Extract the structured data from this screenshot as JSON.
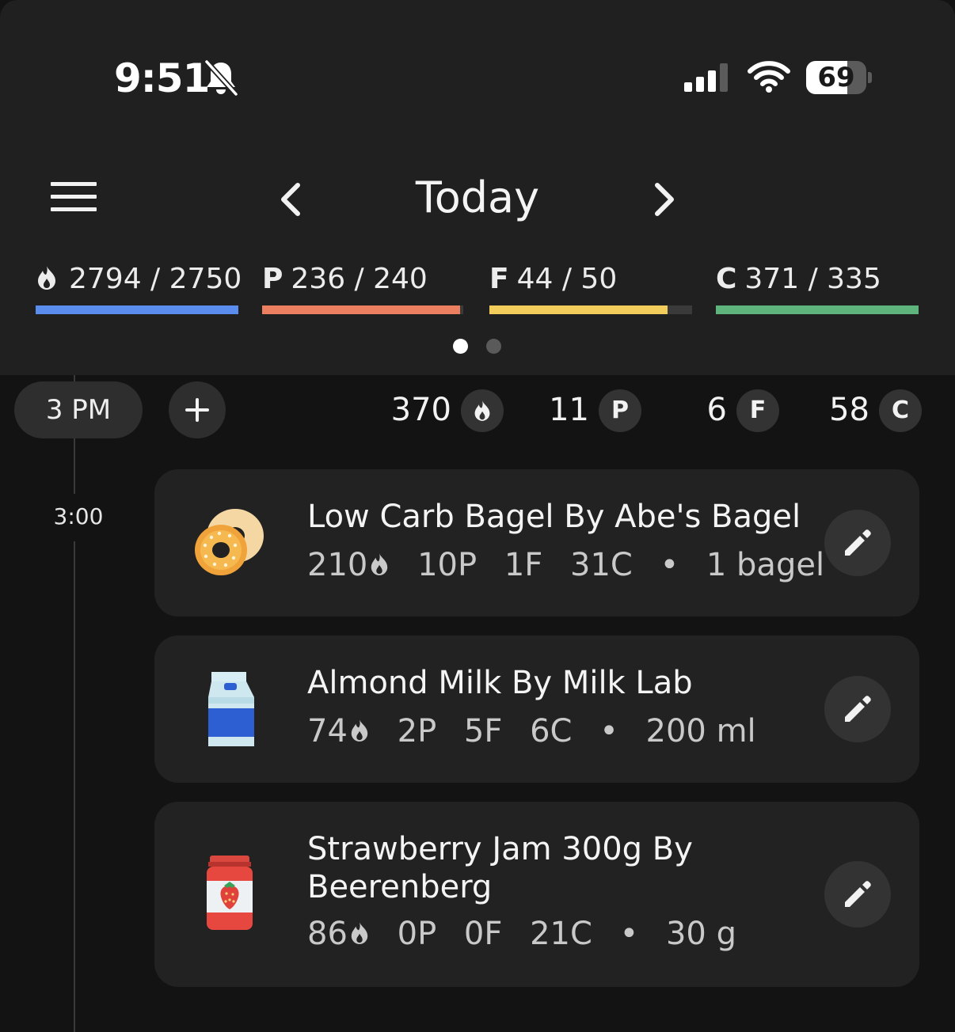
{
  "status": {
    "time": "9:51",
    "battery": "69",
    "battery_level": 0.69
  },
  "header": {
    "title": "Today",
    "icons": [
      "menu-icon",
      "chevron-left-icon",
      "chevron-right-icon"
    ]
  },
  "macros": [
    {
      "letter": "",
      "icon": "flame-icon",
      "text": "2794 / 2750",
      "progress": 1.0,
      "color": "#5b8def"
    },
    {
      "letter": "P",
      "text": "236 / 240",
      "progress": 0.983,
      "color": "#ec7f60"
    },
    {
      "letter": "F",
      "text": "44 / 50",
      "progress": 0.88,
      "color": "#f3cd5c"
    },
    {
      "letter": "C",
      "text": "371 / 335",
      "progress": 1.0,
      "color": "#5fb37c"
    }
  ],
  "pager": {
    "active": 0,
    "count": 2
  },
  "group": {
    "time_label": "3 PM",
    "stamp": "3:00",
    "totals": [
      {
        "value": "370",
        "badge": "",
        "icon": "flame-icon"
      },
      {
        "value": "11",
        "badge": "P"
      },
      {
        "value": "6",
        "badge": "F"
      },
      {
        "value": "58",
        "badge": "C"
      }
    ]
  },
  "foods": [
    {
      "name": "Low Carb Bagel By Abe's Bagel",
      "calories": "210",
      "protein": "10P",
      "fat": "1F",
      "carbs": "31C",
      "separator": "•",
      "serving": "1 bagel",
      "icon": "bagel-icon"
    },
    {
      "name": "Almond Milk By Milk Lab",
      "calories": "74",
      "protein": "2P",
      "fat": "5F",
      "carbs": "6C",
      "separator": "•",
      "serving": "200 ml",
      "icon": "milk-carton-icon"
    },
    {
      "name": "Strawberry Jam 300g By Beerenberg",
      "calories": "86",
      "protein": "0P",
      "fat": "0F",
      "carbs": "21C",
      "separator": "•",
      "serving": "30 g",
      "icon": "jam-jar-icon"
    }
  ]
}
